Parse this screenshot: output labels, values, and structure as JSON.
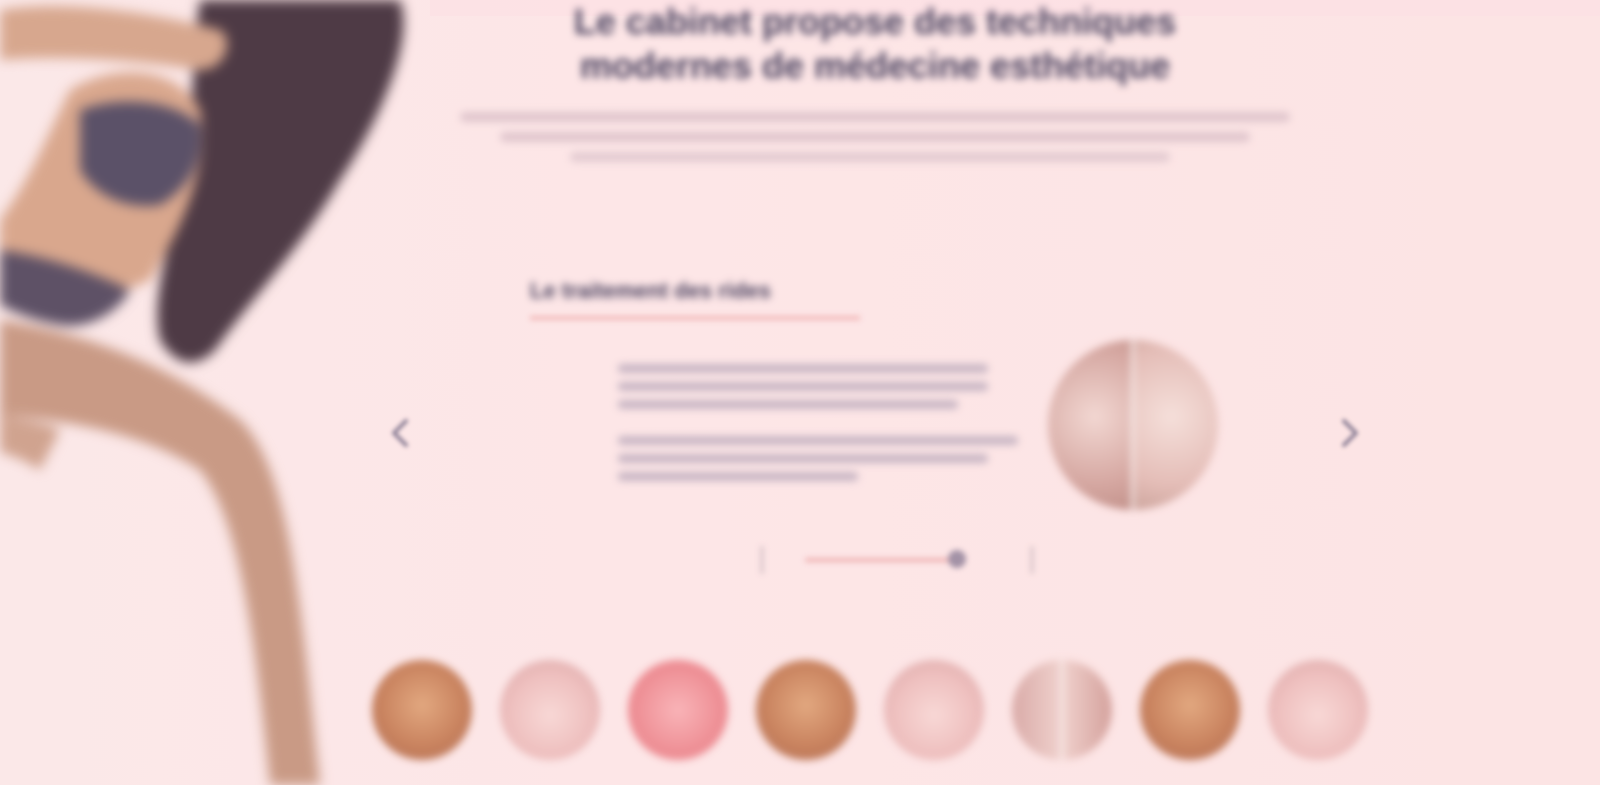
{
  "colors": {
    "background": "#fbe4e5",
    "heading": "#4b4360",
    "accent": "#efb2b2",
    "muted_text": "#b9a5b0"
  },
  "header": {
    "title": "Le cabinet propose des techniques modernes de médecine esthétique"
  },
  "section": {
    "title": "Le traitement des rides"
  },
  "carousel": {
    "prev_icon": "chevron-left-icon",
    "next_icon": "chevron-right-icon"
  },
  "thumbnails": [
    {
      "name": "thumb-1",
      "tone": "warm"
    },
    {
      "name": "thumb-2",
      "tone": "face"
    },
    {
      "name": "thumb-3",
      "tone": "pink"
    },
    {
      "name": "thumb-4",
      "tone": "warm"
    },
    {
      "name": "thumb-5",
      "tone": "face"
    },
    {
      "name": "thumb-6",
      "tone": "split"
    },
    {
      "name": "thumb-7",
      "tone": "warm"
    },
    {
      "name": "thumb-8",
      "tone": "face"
    }
  ]
}
